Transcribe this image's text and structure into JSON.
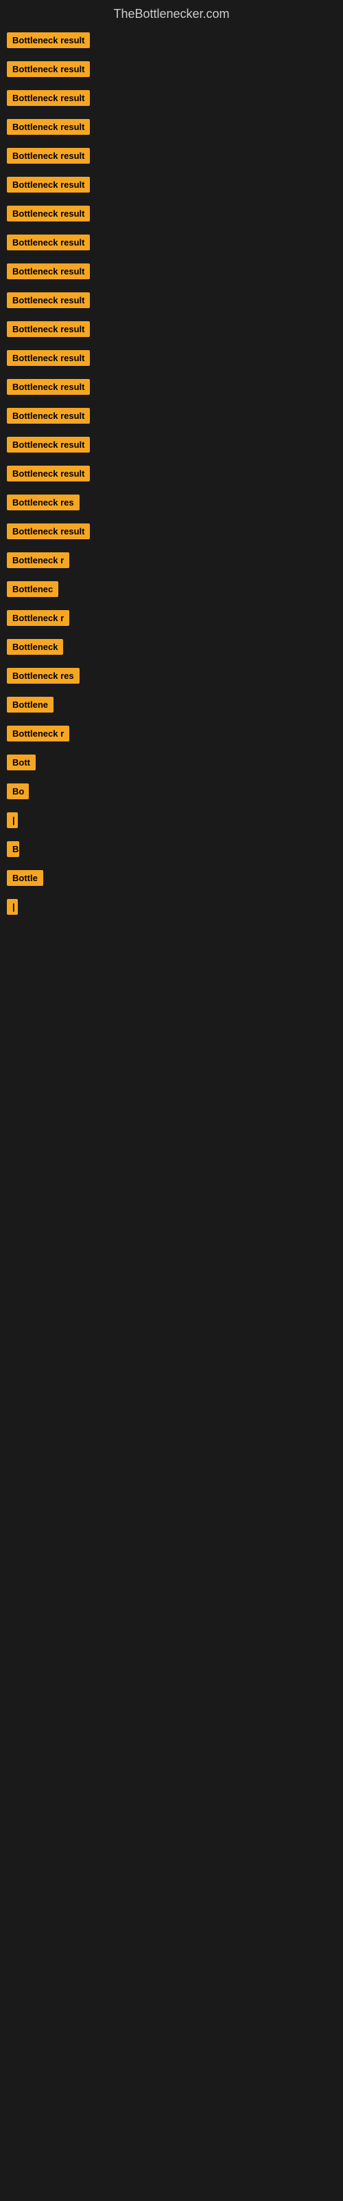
{
  "site": {
    "title": "TheBottlenecker.com"
  },
  "items": [
    {
      "label": "Bottleneck result",
      "width": 160
    },
    {
      "label": "Bottleneck result",
      "width": 155
    },
    {
      "label": "Bottleneck result",
      "width": 155
    },
    {
      "label": "Bottleneck result",
      "width": 150
    },
    {
      "label": "Bottleneck result",
      "width": 155
    },
    {
      "label": "Bottleneck result",
      "width": 150
    },
    {
      "label": "Bottleneck result",
      "width": 150
    },
    {
      "label": "Bottleneck result",
      "width": 148
    },
    {
      "label": "Bottleneck result",
      "width": 148
    },
    {
      "label": "Bottleneck result",
      "width": 145
    },
    {
      "label": "Bottleneck result",
      "width": 145
    },
    {
      "label": "Bottleneck result",
      "width": 140
    },
    {
      "label": "Bottleneck result",
      "width": 138
    },
    {
      "label": "Bottleneck result",
      "width": 135
    },
    {
      "label": "Bottleneck result",
      "width": 132
    },
    {
      "label": "Bottleneck result",
      "width": 130
    },
    {
      "label": "Bottleneck res",
      "width": 118
    },
    {
      "label": "Bottleneck result",
      "width": 128
    },
    {
      "label": "Bottleneck r",
      "width": 105
    },
    {
      "label": "Bottlenec",
      "width": 92
    },
    {
      "label": "Bottleneck r",
      "width": 105
    },
    {
      "label": "Bottleneck",
      "width": 98
    },
    {
      "label": "Bottleneck res",
      "width": 118
    },
    {
      "label": "Bottlene",
      "width": 85
    },
    {
      "label": "Bottleneck r",
      "width": 105
    },
    {
      "label": "Bott",
      "width": 52
    },
    {
      "label": "Bo",
      "width": 32
    },
    {
      "label": "|",
      "width": 10
    },
    {
      "label": "B",
      "width": 18
    },
    {
      "label": "Bottle",
      "width": 58
    },
    {
      "label": "|",
      "width": 10
    }
  ]
}
